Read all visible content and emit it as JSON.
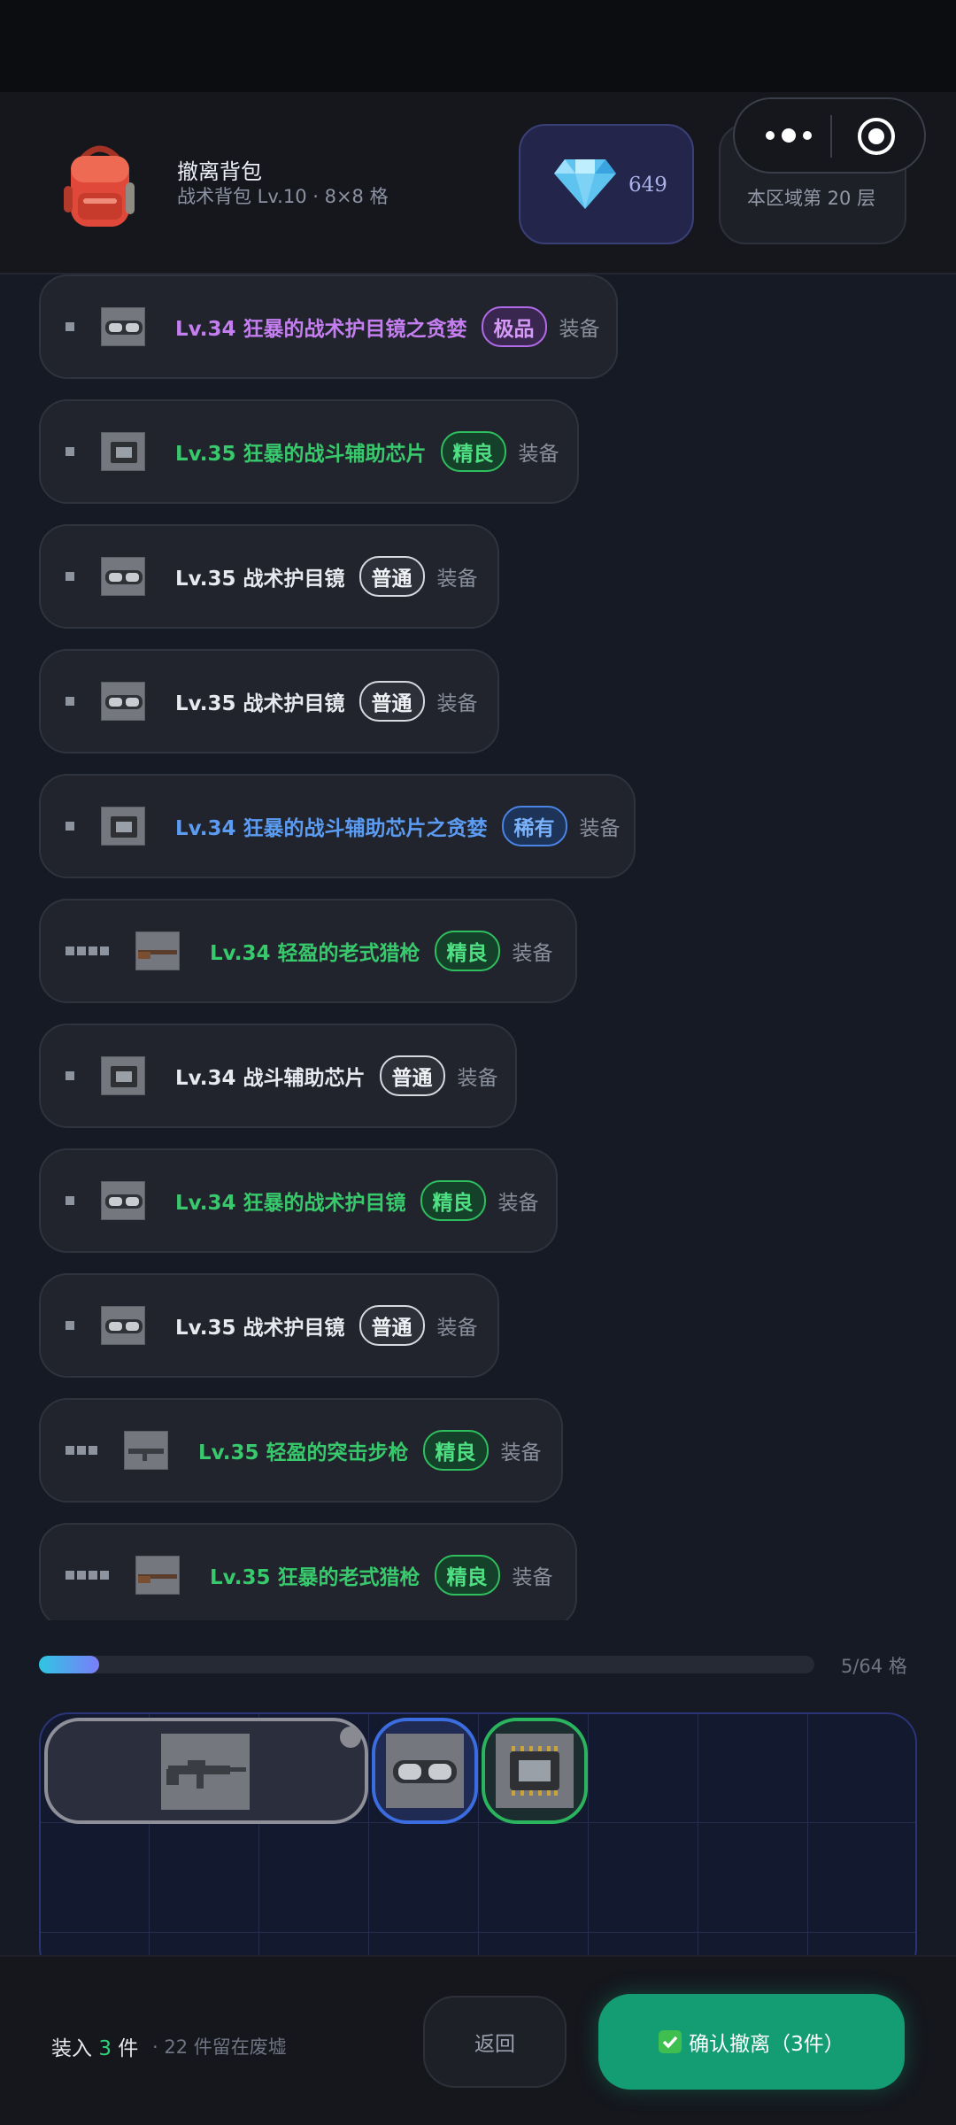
{
  "bag": {
    "title": "撤离背包",
    "subtitle": "战术背包 Lv.10 · 8×8 格",
    "gems": "649",
    "floor": "本区域第 20 层",
    "icon": "backpack-icon"
  },
  "items": [
    {
      "name": "Lv.34 狂暴的战术护目镜之贪婪",
      "tag": "极品",
      "equip": "装备",
      "quality": "epic",
      "icon": "goggles-icon",
      "grip": 1
    },
    {
      "name": "Lv.35 狂暴的战斗辅助芯片",
      "tag": "精良",
      "equip": "装备",
      "quality": "good",
      "icon": "chip-icon",
      "grip": 1
    },
    {
      "name": "Lv.35 战术护目镜",
      "tag": "普通",
      "equip": "装备",
      "quality": "common",
      "icon": "goggles-icon",
      "grip": 1
    },
    {
      "name": "Lv.35 战术护目镜",
      "tag": "普通",
      "equip": "装备",
      "quality": "common",
      "icon": "goggles-icon",
      "grip": 1
    },
    {
      "name": "Lv.34 狂暴的战斗辅助芯片之贪婪",
      "tag": "稀有",
      "equip": "装备",
      "quality": "rare",
      "icon": "chip-icon",
      "grip": 1
    },
    {
      "name": "Lv.34 轻盈的老式猎枪",
      "tag": "精良",
      "equip": "装备",
      "quality": "good",
      "icon": "shotgun-icon",
      "grip": 4
    },
    {
      "name": "Lv.34 战斗辅助芯片",
      "tag": "普通",
      "equip": "装备",
      "quality": "common",
      "icon": "chip-icon",
      "grip": 1
    },
    {
      "name": "Lv.34 狂暴的战术护目镜",
      "tag": "精良",
      "equip": "装备",
      "quality": "good",
      "icon": "goggles-icon",
      "grip": 1
    },
    {
      "name": "Lv.35 战术护目镜",
      "tag": "普通",
      "equip": "装备",
      "quality": "common",
      "icon": "goggles-icon",
      "grip": 1
    },
    {
      "name": "Lv.35 轻盈的突击步枪",
      "tag": "精良",
      "equip": "装备",
      "quality": "good",
      "icon": "rifle-icon",
      "grip": 3
    },
    {
      "name": "Lv.35 狂暴的老式猎枪",
      "tag": "精良",
      "equip": "装备",
      "quality": "good",
      "icon": "shotgun-icon",
      "grip": 4
    }
  ],
  "capacity": {
    "label": "5/64 格",
    "fill_fraction": 0.078
  },
  "footer": {
    "load_prefix": "装入",
    "load_count": "3",
    "load_suffix": "件",
    "remain": "· 22 件留在废墟",
    "back": "返回",
    "confirm": "确认撤离（3件）"
  },
  "colors": {
    "epic": "#c47ef0",
    "good": "#37c96b",
    "common": "#e7e9ef",
    "rare": "#5b9cf2",
    "confirm": "#149d72"
  }
}
